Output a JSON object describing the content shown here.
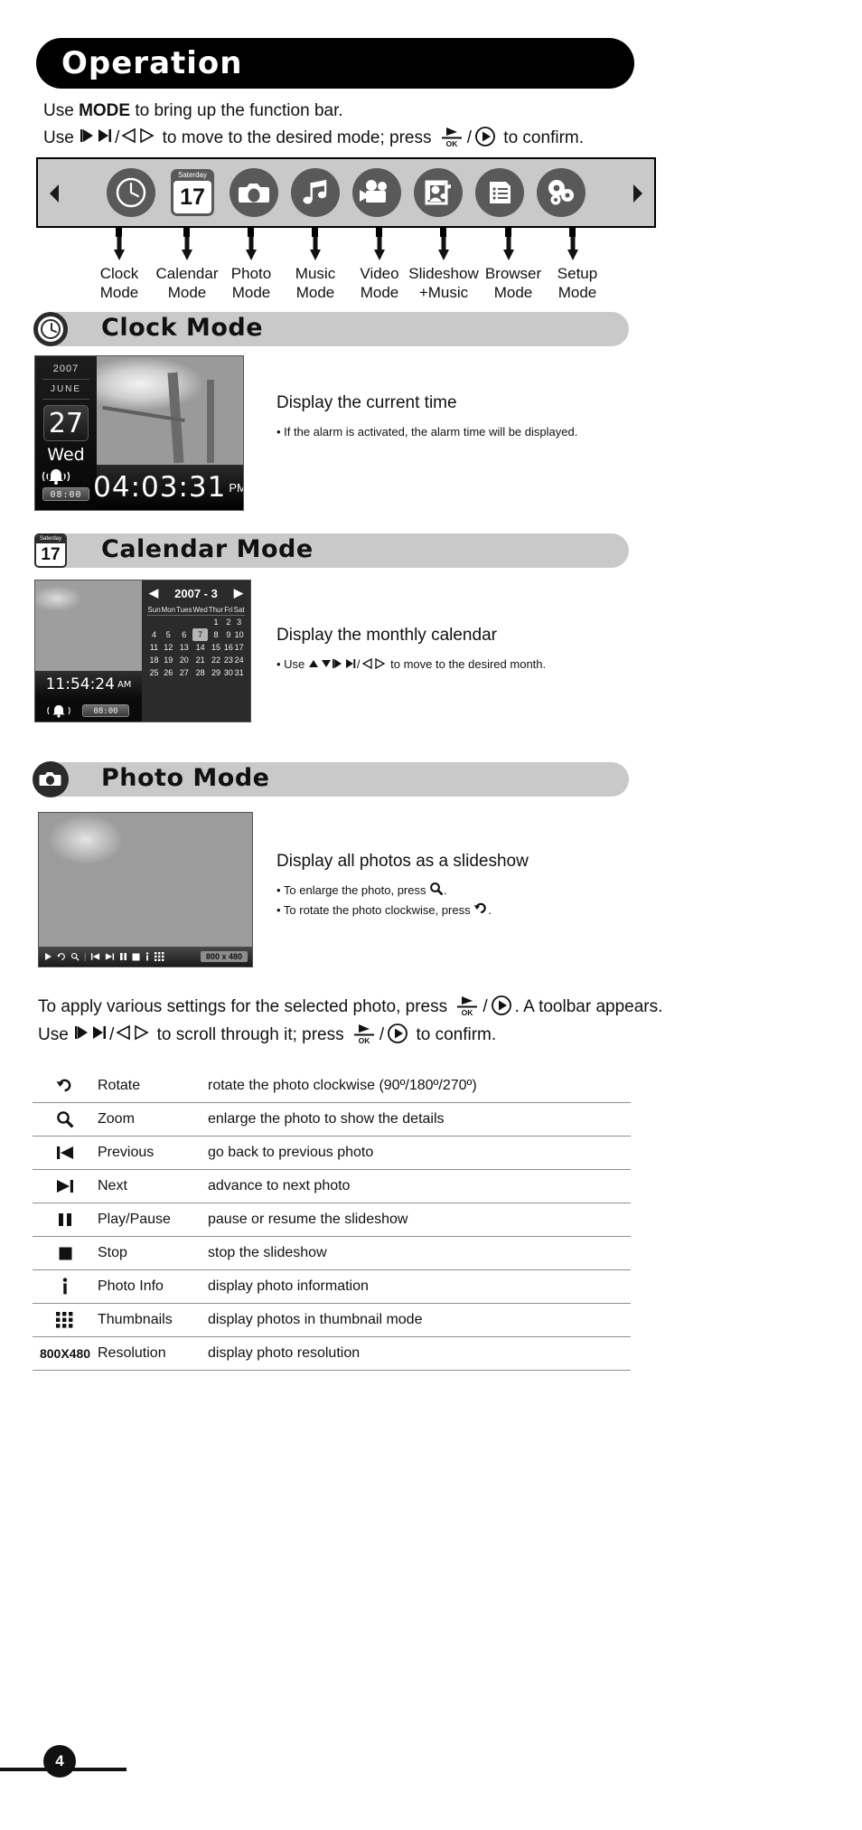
{
  "banner": {
    "title": "Operation"
  },
  "intro": {
    "line1_pre": "Use ",
    "line1_bold": "MODE",
    "line1_post": " to bring up the function bar.",
    "line2_pre": "Use ",
    "line2_mid": " to move to the desired mode; press ",
    "line2_post": " to confirm.",
    "slash": "/",
    "ok_label": "OK"
  },
  "modebar": {
    "left_arrow": "prev-arrow-icon",
    "right_arrow": "next-arrow-icon",
    "calendar_weekday": "Saterday",
    "calendar_day": "17",
    "icons": [
      {
        "name": "clock-mode-icon"
      },
      {
        "name": "calendar-mode-icon"
      },
      {
        "name": "photo-mode-icon"
      },
      {
        "name": "music-mode-icon"
      },
      {
        "name": "video-mode-icon"
      },
      {
        "name": "slideshow-music-mode-icon"
      },
      {
        "name": "browser-mode-icon"
      },
      {
        "name": "setup-mode-icon"
      }
    ],
    "labels": [
      {
        "line1": "Clock",
        "line2": "Mode"
      },
      {
        "line1": "Calendar",
        "line2": "Mode"
      },
      {
        "line1": "Photo",
        "line2": "Mode"
      },
      {
        "line1": "Music",
        "line2": "Mode"
      },
      {
        "line1": "Video",
        "line2": "Mode"
      },
      {
        "line1": "Slideshow",
        "line2": "+Music"
      },
      {
        "line1": "Browser",
        "line2": "Mode"
      },
      {
        "line1": "Setup",
        "line2": "Mode"
      }
    ]
  },
  "sections": {
    "clock": {
      "title": "Clock Mode"
    },
    "calendar": {
      "title": "Calendar Mode"
    },
    "photo": {
      "title": "Photo Mode"
    }
  },
  "clock_screen": {
    "year": "2007",
    "month": "JUNE",
    "day": "27",
    "weekday": "Wed",
    "alarm_time": "08:00",
    "time": "04:03:31",
    "ampm": "PM"
  },
  "clock_desc": {
    "title": "Display the current time",
    "bullet1": "• If the alarm is activated, the alarm time will be displayed."
  },
  "calendar_screen": {
    "time": "11:54:24",
    "ampm": "AM",
    "alarm_time": "08:00",
    "header": "2007 - 3",
    "prev": "◀",
    "next": "▶",
    "weekdays": [
      "Sun",
      "Mon",
      "Tues",
      "Wed",
      "Thur",
      "Fri",
      "Sat"
    ],
    "weeks": [
      [
        "",
        "",
        "",
        "",
        "1",
        "2",
        "3"
      ],
      [
        "4",
        "5",
        "6",
        "7",
        "8",
        "9",
        "10"
      ],
      [
        "11",
        "12",
        "13",
        "14",
        "15",
        "16",
        "17"
      ],
      [
        "18",
        "19",
        "20",
        "21",
        "22",
        "23",
        "24"
      ],
      [
        "25",
        "26",
        "27",
        "28",
        "29",
        "30",
        "31"
      ]
    ],
    "selected": "7"
  },
  "calendar_desc": {
    "title": "Display the monthly calendar",
    "bullet1_pre": "• Use ",
    "bullet1_post": " to move to the desired month."
  },
  "photo_screen": {
    "resolution": "800 x 480",
    "toolbar_icons": [
      "play-icon",
      "rotate-icon",
      "zoom-icon",
      "previous-icon",
      "next-icon",
      "pause-icon",
      "stop-icon",
      "photo-info-icon",
      "thumbnails-icon"
    ]
  },
  "photo_desc": {
    "title": "Display all photos as a slideshow",
    "bullet1_pre": "• To enlarge the photo, press ",
    "bullet1_post": ".",
    "bullet2_pre": "• To rotate the photo clockwise, press ",
    "bullet2_post": "."
  },
  "paragraph": {
    "line1_pre": "To apply various settings for the selected photo, press ",
    "line1_post": ". A toolbar appears.",
    "line2_pre": "Use ",
    "line2_mid": " to scroll through it; press ",
    "line2_post": " to confirm."
  },
  "toolbar_table": {
    "rows": [
      {
        "icon": "rotate-icon",
        "name": "Rotate",
        "desc": "rotate the photo clockwise (90º/180º/270º)"
      },
      {
        "icon": "zoom-icon",
        "name": "Zoom",
        "desc": "enlarge the photo to show the details"
      },
      {
        "icon": "previous-icon",
        "name": "Previous",
        "desc": "go back to previous photo"
      },
      {
        "icon": "next-icon",
        "name": "Next",
        "desc": "advance to next photo"
      },
      {
        "icon": "pause-icon",
        "name": "Play/Pause",
        "desc": "pause or resume the slideshow"
      },
      {
        "icon": "stop-icon",
        "name": "Stop",
        "desc": "stop the slideshow"
      },
      {
        "icon": "photo-info-icon",
        "name": "Photo Info",
        "desc": "display photo information"
      },
      {
        "icon": "thumbnails-icon",
        "name": "Thumbnails",
        "desc": "display photos in thumbnail mode"
      },
      {
        "icon": "resolution-icon",
        "name": "Resolution",
        "desc": "display photo resolution",
        "glyph": "800X480"
      }
    ]
  },
  "footer": {
    "page_number": "4"
  },
  "colors": {
    "banner_bg": "#000000",
    "section_bar": "#c9c9c9",
    "modebar_bg": "#c9c9c9",
    "icon_circle": "#595959"
  }
}
